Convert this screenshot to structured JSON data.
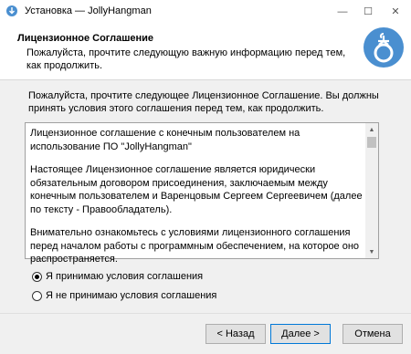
{
  "window": {
    "title": "Установка — JollyHangman",
    "minimize_symbol": "—",
    "maximize_symbol": "☐",
    "close_symbol": "✕"
  },
  "header": {
    "title": "Лицензионное Соглашение",
    "subtitle": "Пожалуйста, прочтите следующую важную информацию перед тем, как продолжить."
  },
  "intro": "Пожалуйста, прочтите следующее Лицензионное Соглашение. Вы должны принять условия этого соглашения перед тем, как продолжить.",
  "license": {
    "paragraphs": [
      "Лицензионное соглашение с конечным пользователем на использование ПО \"JollyHangman\"",
      "Настоящее Лицензионное соглашение является юридически обязательным договором присоединения, заключаемым между конечным пользователем и Варенцовым Сергеем Сергеевичем (далее по тексту - Правообладатель).",
      "Внимательно ознакомьтесь с условиями лицензионного соглашения перед началом работы с программным обеспечением, на которое оно распространяется."
    ]
  },
  "options": {
    "accept": "Я принимаю условия соглашения",
    "decline": "Я не принимаю условия соглашения",
    "selected": "accept"
  },
  "buttons": {
    "back": "< Назад",
    "next": "Далее >",
    "cancel": "Отмена"
  },
  "icons": {
    "app": "setup-icon",
    "logo": "hangman-logo-icon",
    "scroll_up": "▲",
    "scroll_down": "▼"
  },
  "colors": {
    "logo_blue": "#4a8fd0",
    "focus_border": "#0078d7"
  }
}
